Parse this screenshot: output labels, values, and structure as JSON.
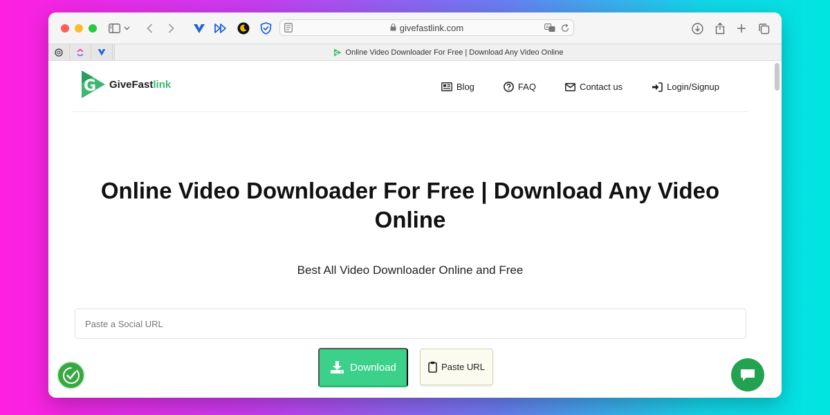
{
  "browser": {
    "url": "givefastlink.com",
    "tab_title": "Online Video Downloader For Free | Download Any Video Online",
    "traffic_lights": [
      "#fe5f57",
      "#febc2e",
      "#28c840"
    ]
  },
  "site": {
    "logo": {
      "brand_main": "GiveFast",
      "brand_accent": "link",
      "accent_color": "#3cb873"
    },
    "nav": [
      {
        "label": "Blog",
        "icon": "newspaper-icon"
      },
      {
        "label": "FAQ",
        "icon": "question-circle-icon"
      },
      {
        "label": "Contact us",
        "icon": "envelope-icon"
      },
      {
        "label": "Login/Signup",
        "icon": "sign-in-icon"
      }
    ],
    "headline": "Online Video Downloader For Free | Download Any Video Online",
    "subheadline": "Best All Video Downloader Online and Free",
    "url_input": {
      "placeholder": "Paste a Social URL",
      "value": ""
    },
    "download_button": {
      "label": "Download",
      "color": "#3cd18a"
    },
    "paste_button": {
      "label": "Paste URL"
    }
  }
}
